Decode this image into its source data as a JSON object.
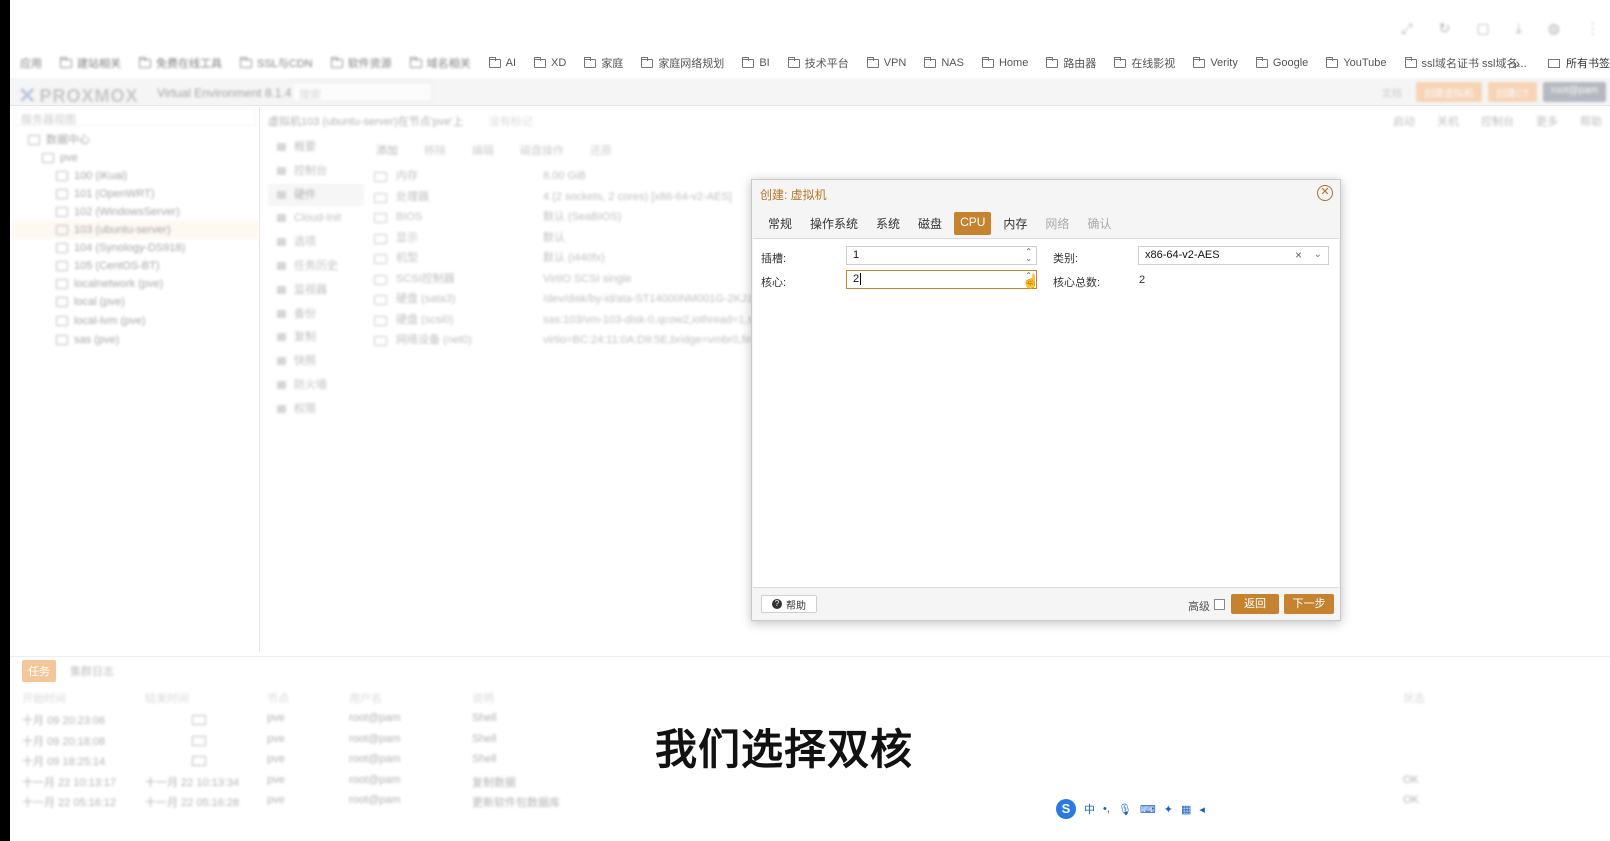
{
  "browser": {
    "bookmarks": [
      "应用",
      "建站相关",
      "免费在线工具",
      "SSL与CDN",
      "软件资源",
      "域名相关",
      "AI",
      "XD",
      "家庭",
      "家庭网络规划",
      "BI",
      "技术平台",
      "VPN",
      "NAS",
      "Home",
      "路由器",
      "在线影视",
      "Verity",
      "Google",
      "YouTube",
      "ssl域名证书 ssl域名..."
    ],
    "more_label": "»",
    "all_bookmarks_label": "所有书签"
  },
  "pve": {
    "logo": "PROXMOX",
    "version": "Virtual Environment 8.1.4",
    "search_placeholder": "搜索",
    "header_buttons": [
      "文档",
      "创建虚拟机",
      "创建CT",
      "root@pam"
    ],
    "tree_view_label": "服务器视图",
    "tree": [
      {
        "label": "数据中心",
        "level": 0
      },
      {
        "label": "pve",
        "level": 1
      },
      {
        "label": "100 (iKuai)",
        "level": 2
      },
      {
        "label": "101 (OpenWRT)",
        "level": 2
      },
      {
        "label": "102 (WindowsServer)",
        "level": 2
      },
      {
        "label": "103 (ubuntu-server)",
        "level": 2,
        "selected": true
      },
      {
        "label": "104 (Synology-DS918)",
        "level": 2
      },
      {
        "label": "105 (CentOS-BT)",
        "level": 2
      },
      {
        "label": "localnetwork (pve)",
        "level": 2
      },
      {
        "label": "local (pve)",
        "level": 2
      },
      {
        "label": "local-lvm (pve)",
        "level": 2
      },
      {
        "label": "sas (pve)",
        "level": 2
      }
    ],
    "vm_title": "虚拟机103 (ubuntu-server)在节点'pve'上",
    "vm_tags_label": "没有标记",
    "vm_actions": [
      "启动",
      "关机",
      "控制台",
      "更多",
      "帮助"
    ],
    "nav": [
      "概要",
      "控制台",
      "硬件",
      "Cloud-Init",
      "选项",
      "任务历史",
      "监视器",
      "备份",
      "复制",
      "快照",
      "防火墙",
      "权限"
    ],
    "hw_toolbar": [
      "添加",
      "移除",
      "编辑",
      "磁盘操作",
      "还原"
    ],
    "hardware": [
      {
        "key": "内存",
        "value": "8.00 GiB"
      },
      {
        "key": "处理器",
        "value": "4 (2 sockets, 2 cores) [x86-64-v2-AES]"
      },
      {
        "key": "BIOS",
        "value": "默认 (SeaBIOS)"
      },
      {
        "key": "显示",
        "value": "默认"
      },
      {
        "key": "机型",
        "value": "默认 (i440fx)"
      },
      {
        "key": "SCSI控制器",
        "value": "VirtIO SCSI single"
      },
      {
        "key": "硬盘 (sata3)",
        "value": "/dev/disk/by-id/ata-ST14000NM001G-2KJ103_"
      },
      {
        "key": "硬盘 (scsi0)",
        "value": "sas:103/vm-103-disk-0.qcow2,iothread=1,size"
      },
      {
        "key": "网络设备 (net0)",
        "value": "virtio=BC:24:11:0A:D9:5E,bridge=vmbr0,firewa"
      }
    ],
    "tasks": {
      "tabs": [
        "任务",
        "集群日志"
      ],
      "columns": [
        "开始时间",
        "结束时间",
        "节点",
        "用户名",
        "说明",
        "状态"
      ],
      "rows": [
        {
          "start": "十月 09 20:23:06",
          "end": "",
          "node": "pve",
          "user": "root@pam",
          "desc": "Shell",
          "status": ""
        },
        {
          "start": "十月 09 20:18:08",
          "end": "",
          "node": "pve",
          "user": "root@pam",
          "desc": "Shell",
          "status": ""
        },
        {
          "start": "十月 09 18:25:14",
          "end": "",
          "node": "pve",
          "user": "root@pam",
          "desc": "Shell",
          "status": ""
        },
        {
          "start": "十一月 22 10:13:17",
          "end": "十一月 22 10:13:34",
          "node": "pve",
          "user": "root@pam",
          "desc": "复制数据",
          "status": "OK"
        },
        {
          "start": "十一月 22 05:16:12",
          "end": "十一月 22 05:16:28",
          "node": "pve",
          "user": "root@pam",
          "desc": "更新软件包数据库",
          "status": "OK"
        }
      ]
    }
  },
  "dialog": {
    "title": "创建: 虚拟机",
    "tabs": [
      "常规",
      "操作系统",
      "系统",
      "磁盘",
      "CPU",
      "内存",
      "网络",
      "确认"
    ],
    "active_tab": "CPU",
    "sockets_label": "插槽:",
    "sockets_value": "1",
    "cores_label": "核心:",
    "cores_value": "2",
    "type_label": "类别:",
    "type_value": "x86-64-v2-AES",
    "total_cores_label": "核心总数:",
    "total_cores_value": "2",
    "help_label": "帮助",
    "advanced_label": "高级",
    "back_label": "返回",
    "next_label": "下一步"
  },
  "overlay": {
    "subtitle": "我们选择双核",
    "ime_mode": "中"
  },
  "colors": {
    "accent": "#c5832f",
    "accent_light": "#f7c9a0"
  }
}
